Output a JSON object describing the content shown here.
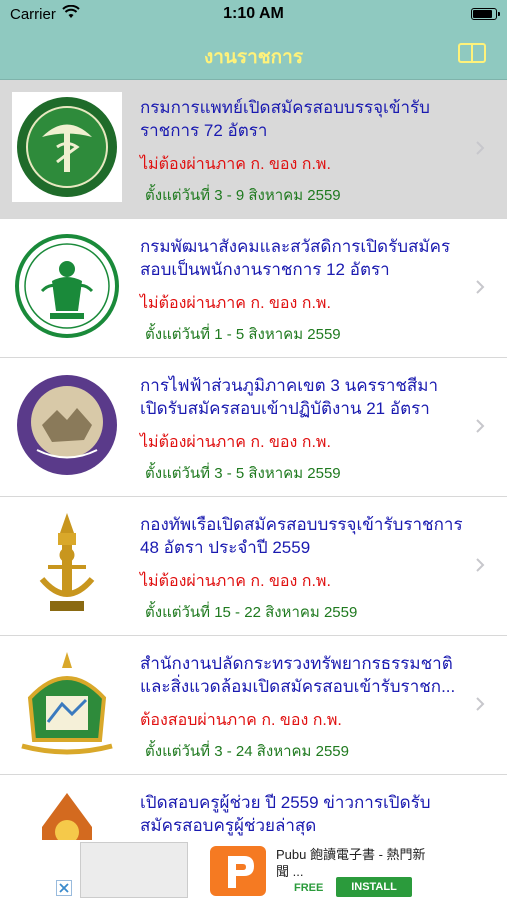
{
  "status_bar": {
    "carrier": "Carrier",
    "time": "1:10 AM"
  },
  "nav": {
    "title": "งานราชการ"
  },
  "items": [
    {
      "title": "กรมการแพทย์เปิดสมัครสอบบรรจุเข้ารับราชการ 72 อัตรา",
      "status": "ไม่ต้องผ่านภาค ก. ของ ก.พ.",
      "date": "ตั้งแต่วันที่ 3 - 9 สิงหาคม 2559",
      "selected": true
    },
    {
      "title": "กรมพัฒนาสังคมและสวัสดิการเปิดรับสมัครสอบเป็นพนักงานราชการ 12 อัตรา",
      "status": "ไม่ต้องผ่านภาค ก. ของ ก.พ.",
      "date": "ตั้งแต่วันที่ 1 - 5 สิงหาคม 2559",
      "selected": false
    },
    {
      "title": "การไฟฟ้าส่วนภูมิภาคเขต 3 นครราชสีมา เปิดรับสมัครสอบเข้าปฏิบัติงาน 21 อัตรา",
      "status": "ไม่ต้องผ่านภาค ก. ของ ก.พ.",
      "date": "ตั้งแต่วันที่ 3 - 5 สิงหาคม 2559",
      "selected": false
    },
    {
      "title": "กองทัพเรือเปิดสมัครสอบบรรจุเข้ารับราชการ 48 อัตรา ประจำปี 2559",
      "status": "ไม่ต้องผ่านภาค ก. ของ ก.พ.",
      "date": "ตั้งแต่วันที่ 15 - 22 สิงหาคม 2559",
      "selected": false
    },
    {
      "title": "สำนักงานปลัดกระทรวงทรัพยากรธรรมชาติและสิ่งแวดล้อมเปิดสมัครสอบเข้ารับราชก...",
      "status": "ต้องสอบผ่านภาค ก. ของ ก.พ.",
      "date": "ตั้งแต่วันที่ 3 - 24 สิงหาคม 2559",
      "selected": false
    },
    {
      "title": "เปิดสอบครูผู้ช่วย ปี 2559 ข่าวการเปิดรับสมัครสอบครูผู้ช่วยล่าสุด",
      "status": "",
      "date": "",
      "selected": false
    }
  ],
  "ad": {
    "title": "Pubu 飽讀電子書 - 熱門新聞 ...",
    "free": "FREE",
    "install": "INSTALL"
  },
  "colors": {
    "nav_bg": "#8fc9c0",
    "nav_title": "#fff27a",
    "item_title": "#1a1ab0",
    "status_red": "#e01010",
    "date_green": "#1f7a1f"
  }
}
